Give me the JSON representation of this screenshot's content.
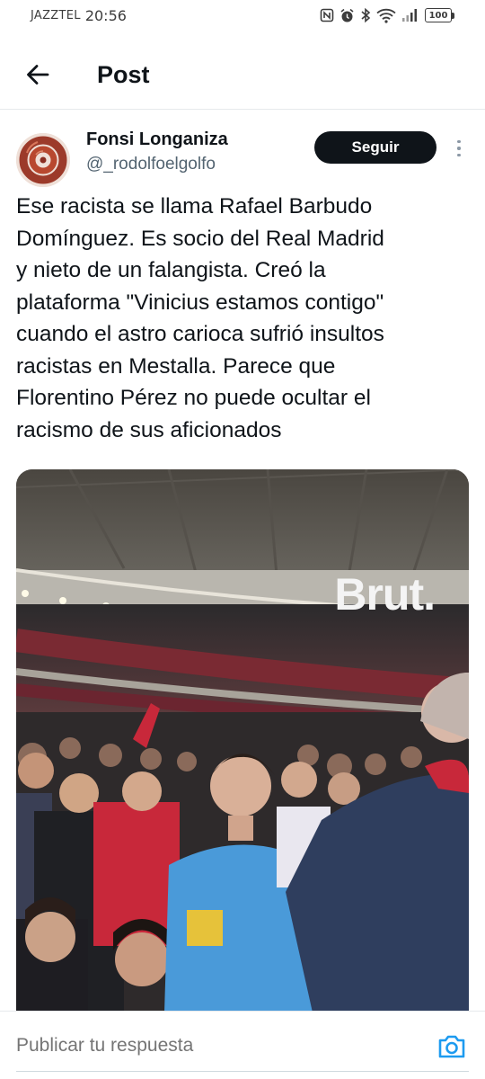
{
  "status_bar": {
    "carrier": "JAZZTEL",
    "time": "20:56",
    "battery": "100",
    "icons": [
      "nfc-icon",
      "alarm-icon",
      "bluetooth-icon",
      "wifi-icon",
      "signal-icon",
      "battery-icon"
    ]
  },
  "header": {
    "back_icon": "arrow-left-icon",
    "title": "Post"
  },
  "author": {
    "name": "Fonsi Longaniza",
    "handle": "@_rodolfoelgolfo",
    "follow_label": "Seguir",
    "more_icon": "more-vertical-icon"
  },
  "tweet": {
    "text": "Ese racista se llama Rafael Barbudo\nDomínguez. Es socio del Real Madrid\ny nieto de un falangista. Creó la\nplataforma \"Vinicius estamos contigo\"\ncuando el astro carioca sufrió insultos\nracistas en Mestalla. Parece que\nFlorentino Pérez no puede ocultar el\nracismo de sus aficionados"
  },
  "media": {
    "watermark": "Brut."
  },
  "reply": {
    "placeholder": "Publicar tu respuesta",
    "camera_icon": "camera-icon"
  },
  "colors": {
    "text_primary": "#0f1419",
    "text_secondary": "#536471",
    "accent": "#1d9bf0",
    "follow_bg": "#0f1419"
  }
}
